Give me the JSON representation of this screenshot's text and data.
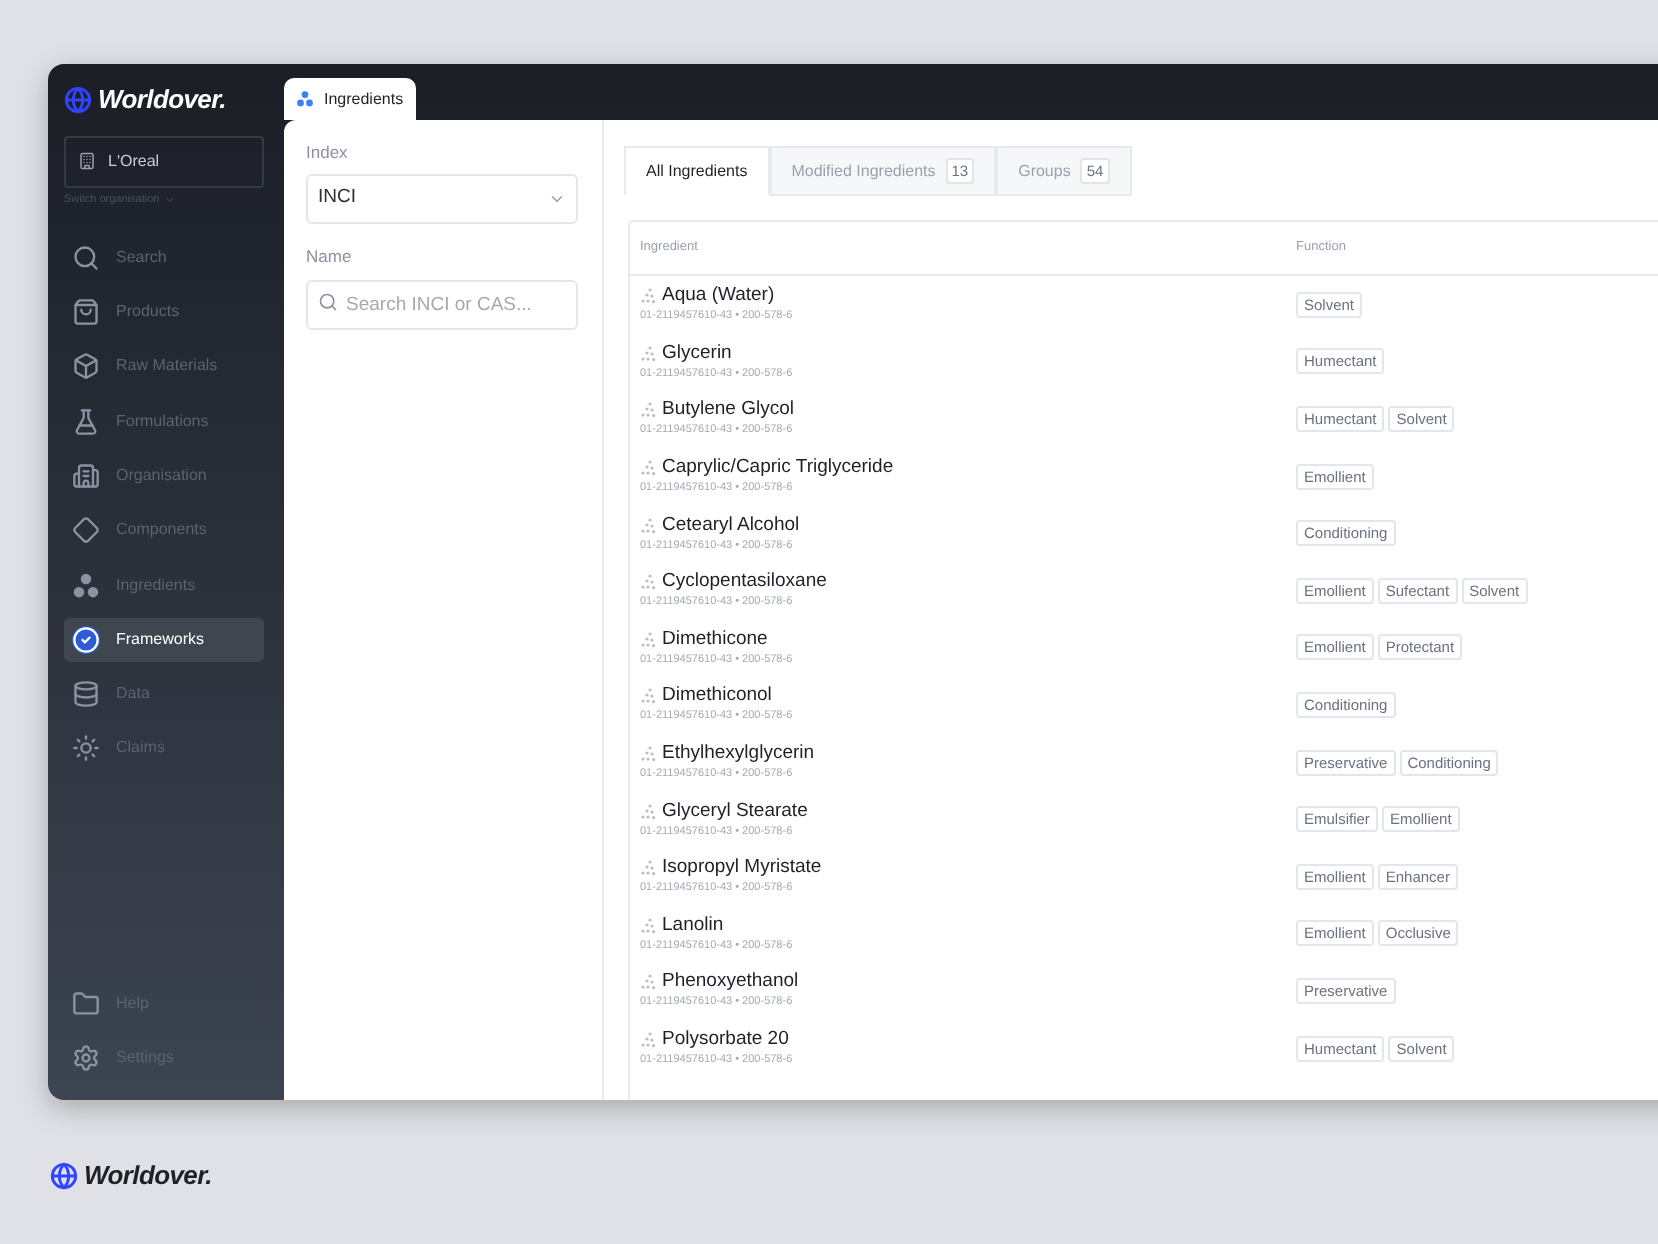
{
  "brand": {
    "name": "Worldover."
  },
  "organisation": {
    "name": "L'Oreal",
    "switch_label": "Switch organisation"
  },
  "nav": [
    {
      "label": "Search",
      "selected": false
    },
    {
      "label": "Products",
      "selected": false
    },
    {
      "label": "Raw Materials",
      "selected": false
    },
    {
      "label": "Formulations",
      "selected": false
    },
    {
      "label": "Organisation",
      "selected": false
    },
    {
      "label": "Components",
      "selected": false
    },
    {
      "label": "Ingredients",
      "selected": false
    },
    {
      "label": "Frameworks",
      "selected": true
    },
    {
      "label": "Data",
      "selected": false
    },
    {
      "label": "Claims",
      "selected": false
    }
  ],
  "footer_nav": [
    {
      "label": "Help",
      "selected": false
    },
    {
      "label": "Settings",
      "selected": false
    }
  ],
  "page_tab": {
    "label": "Ingredients"
  },
  "filters": {
    "index_label": "Index",
    "index_value": "INCI",
    "name_label": "Name",
    "name_placeholder": "Search INCI or CAS..."
  },
  "tabs": [
    {
      "label": "All Ingredients",
      "selected": true
    },
    {
      "label": "Modified Ingredients",
      "count": "13",
      "selected": false
    },
    {
      "label": "Groups",
      "count": "54",
      "selected": false
    }
  ],
  "table": {
    "columns": [
      "Ingredient",
      "Function"
    ],
    "rows": [
      {
        "name": "Aqua (Water)",
        "codes": "01-2119457610-43 • 200-578-6",
        "functions": [
          "Solvent"
        ]
      },
      {
        "name": "Glycerin",
        "codes": "01-2119457610-43 • 200-578-6",
        "functions": [
          "Humectant"
        ]
      },
      {
        "name": "Butylene Glycol",
        "codes": "01-2119457610-43 • 200-578-6",
        "functions": [
          "Humectant",
          "Solvent"
        ]
      },
      {
        "name": "Caprylic/Capric Triglyceride",
        "codes": "01-2119457610-43 • 200-578-6",
        "functions": [
          "Emollient"
        ]
      },
      {
        "name": "Cetearyl Alcohol",
        "codes": "01-2119457610-43 • 200-578-6",
        "functions": [
          "Conditioning"
        ]
      },
      {
        "name": "Cyclopentasiloxane",
        "codes": "01-2119457610-43 • 200-578-6",
        "functions": [
          "Emollient",
          "Sufectant",
          "Solvent"
        ]
      },
      {
        "name": "Dimethicone",
        "codes": "01-2119457610-43 • 200-578-6",
        "functions": [
          "Emollient",
          "Protectant"
        ]
      },
      {
        "name": "Dimethiconol",
        "codes": "01-2119457610-43 • 200-578-6",
        "functions": [
          "Conditioning"
        ]
      },
      {
        "name": "Ethylhexylglycerin",
        "codes": "01-2119457610-43 • 200-578-6",
        "functions": [
          "Preservative",
          "Conditioning"
        ]
      },
      {
        "name": "Glyceryl Stearate",
        "codes": "01-2119457610-43 • 200-578-6",
        "functions": [
          "Emulsifier",
          "Emollient"
        ]
      },
      {
        "name": "Isopropyl Myristate",
        "codes": "01-2119457610-43 • 200-578-6",
        "functions": [
          "Emollient",
          "Enhancer"
        ]
      },
      {
        "name": "Lanolin",
        "codes": "01-2119457610-43 • 200-578-6",
        "functions": [
          "Emollient",
          "Occlusive"
        ]
      },
      {
        "name": "Phenoxyethanol",
        "codes": "01-2119457610-43 • 200-578-6",
        "functions": [
          "Preservative"
        ]
      },
      {
        "name": "Polysorbate 20",
        "codes": "01-2119457610-43 • 200-578-6",
        "functions": [
          "Humectant",
          "Solvent"
        ]
      }
    ]
  },
  "footer_brand": {
    "name": "Worldover."
  }
}
